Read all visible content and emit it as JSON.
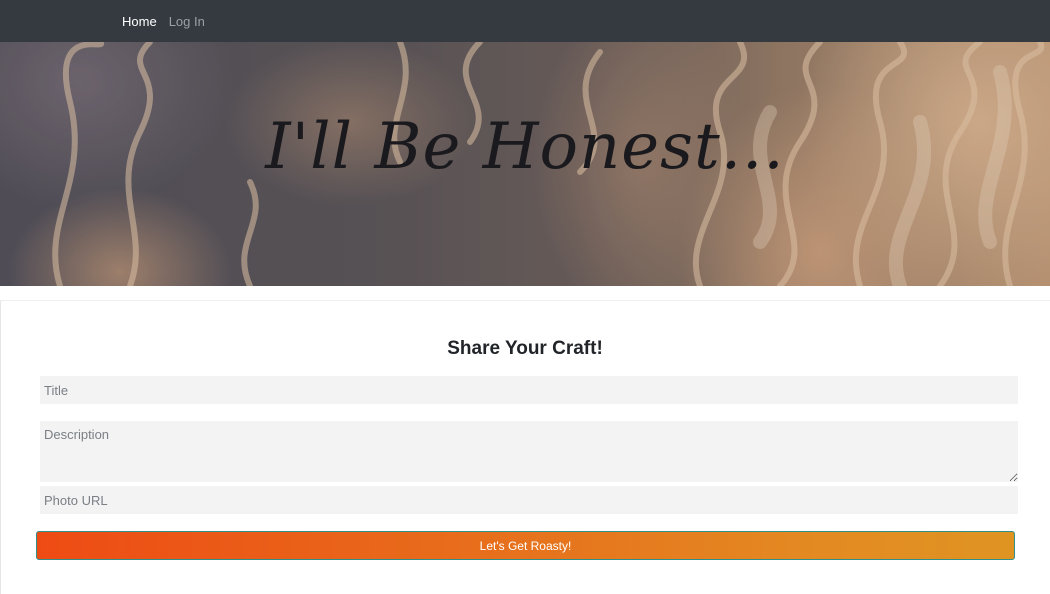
{
  "nav": {
    "links": [
      {
        "label": "Home",
        "active": true
      },
      {
        "label": "Log In",
        "active": false
      }
    ]
  },
  "hero": {
    "title": "I'll Be Honest...",
    "background_image": "flames"
  },
  "form": {
    "heading": "Share Your Craft!",
    "title_placeholder": "Title",
    "description_placeholder": "Description",
    "photo_placeholder": "Photo URL",
    "submit_label": "Let's Get Roasty!"
  },
  "colors": {
    "navbar": "#343a40",
    "button_start": "#ee4b14",
    "button_end": "#df9422",
    "field_bg": "#f3f3f3"
  }
}
